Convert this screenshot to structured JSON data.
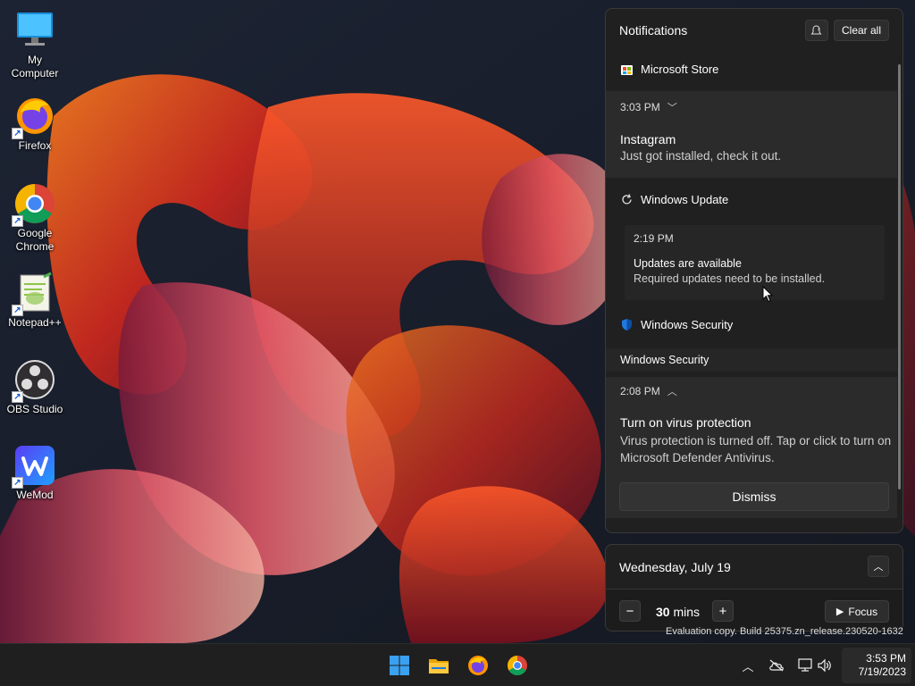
{
  "desktop": {
    "icons": [
      {
        "label": "My Computer"
      },
      {
        "label": "Firefox"
      },
      {
        "label": "Google Chrome"
      },
      {
        "label": "Notepad++"
      },
      {
        "label": "OBS Studio"
      },
      {
        "label": "WeMod"
      }
    ]
  },
  "notifications": {
    "title": "Notifications",
    "clear_all": "Clear all",
    "groups": [
      {
        "app": "Microsoft Store",
        "time": "3:03 PM",
        "title": "Instagram",
        "body": "Just got installed, check it out."
      },
      {
        "app": "Windows Update",
        "time": "2:19 PM",
        "title": "Updates are available",
        "body": "Required updates need to be installed."
      },
      {
        "app": "Windows Security",
        "subheader": "Windows Security",
        "time": "2:08 PM",
        "title": "Turn on virus protection",
        "body": "Virus protection is turned off. Tap or click to turn on Microsoft Defender Antivirus.",
        "dismiss": "Dismiss"
      }
    ]
  },
  "calendar": {
    "date": "Wednesday, July 19",
    "focus_minutes": "30",
    "focus_unit": "mins",
    "focus_label": "Focus"
  },
  "watermark": {
    "text": "Evaluation copy. Build 25375.zn_release.230520-1632"
  },
  "taskbar": {
    "clock_time": "3:53 PM",
    "clock_date": "7/19/2023"
  },
  "colors": {
    "panel_bg": "#202020",
    "card_bg": "#2b2b2b",
    "accent": "#0078d4"
  }
}
